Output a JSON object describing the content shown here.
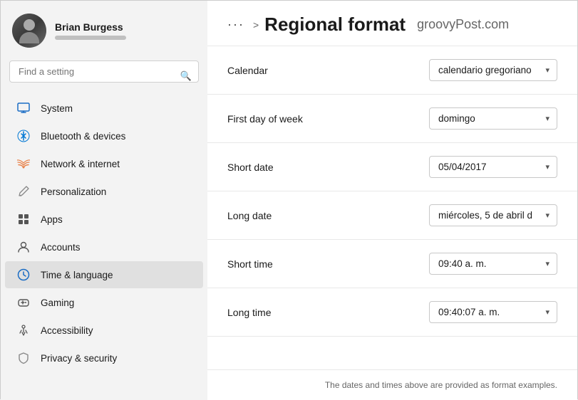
{
  "user": {
    "name": "Brian Burgess"
  },
  "search": {
    "placeholder": "Find a setting"
  },
  "header": {
    "dots": "···",
    "chevron": ">",
    "title": "Regional format",
    "brand": "groovyPost.com"
  },
  "nav": {
    "items": [
      {
        "id": "system",
        "label": "System",
        "icon": "monitor"
      },
      {
        "id": "bluetooth",
        "label": "Bluetooth & devices",
        "icon": "bluetooth"
      },
      {
        "id": "network",
        "label": "Network & internet",
        "icon": "network"
      },
      {
        "id": "personalization",
        "label": "Personalization",
        "icon": "brush"
      },
      {
        "id": "apps",
        "label": "Apps",
        "icon": "grid"
      },
      {
        "id": "accounts",
        "label": "Accounts",
        "icon": "person"
      },
      {
        "id": "time",
        "label": "Time & language",
        "icon": "clock",
        "active": true
      },
      {
        "id": "gaming",
        "label": "Gaming",
        "icon": "gamepad"
      },
      {
        "id": "accessibility",
        "label": "Accessibility",
        "icon": "person-access"
      },
      {
        "id": "privacy",
        "label": "Privacy & security",
        "icon": "shield"
      }
    ]
  },
  "settings": {
    "rows": [
      {
        "id": "calendar",
        "label": "Calendar",
        "value": "calendario gregoriano"
      },
      {
        "id": "first-day",
        "label": "First day of week",
        "value": "domingo"
      },
      {
        "id": "short-date",
        "label": "Short date",
        "value": "05/04/2017"
      },
      {
        "id": "long-date",
        "label": "Long date",
        "value": "miércoles, 5 de abril d"
      },
      {
        "id": "short-time",
        "label": "Short time",
        "value": "09:40 a. m."
      },
      {
        "id": "long-time",
        "label": "Long time",
        "value": "09:40:07 a. m."
      }
    ],
    "footer_note": "The dates and times above are provided as format examples."
  }
}
